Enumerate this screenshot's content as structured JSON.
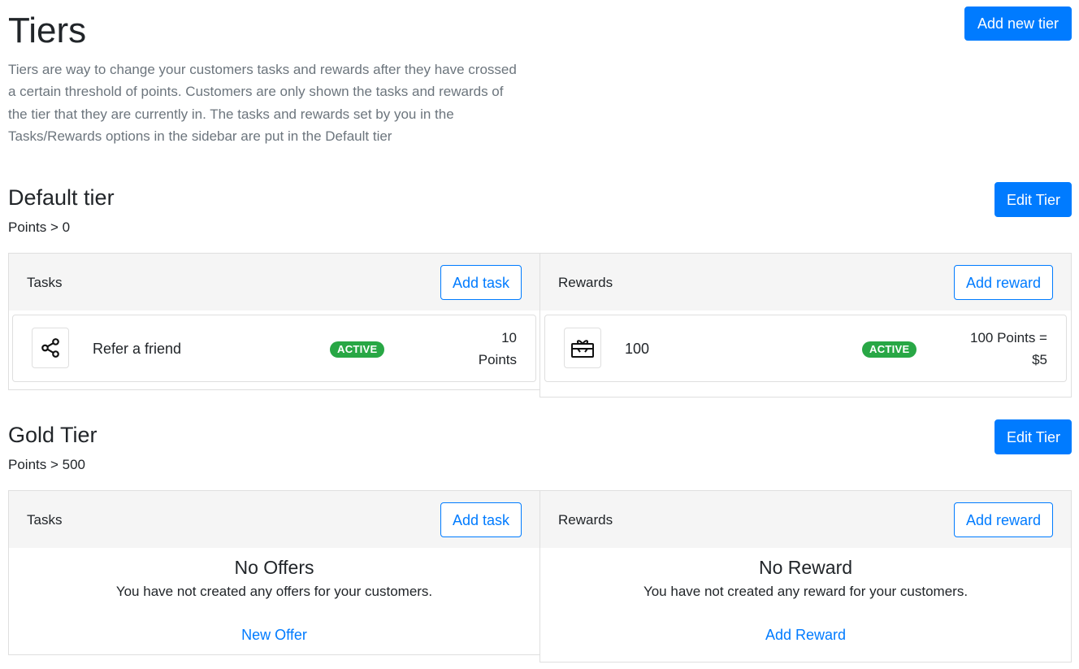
{
  "page": {
    "title": "Tiers",
    "description": "Tiers are way to change your customers tasks and rewards after they have crossed a certain threshold of points. Customers are only shown the tasks and rewards of the tier that they are currently in. The tasks and rewards set by you in the Tasks/Rewards options in the sidebar are put in the Default tier",
    "add_tier_label": "Add new tier"
  },
  "tiers": [
    {
      "name": "Default tier",
      "points": "Points > 0",
      "edit_label": "Edit Tier",
      "tasks": {
        "header": "Tasks",
        "add_label": "Add task",
        "items": [
          {
            "icon": "share-icon",
            "name": "Refer a friend",
            "status": "ACTIVE",
            "value_line1": "10",
            "value_line2": "Points"
          }
        ]
      },
      "rewards": {
        "header": "Rewards",
        "add_label": "Add reward",
        "items": [
          {
            "icon": "gift-card-icon",
            "name": "100",
            "status": "ACTIVE",
            "value_line1": "100 Points =",
            "value_line2": "$5"
          }
        ]
      }
    },
    {
      "name": "Gold Tier",
      "points": "Points > 500",
      "edit_label": "Edit Tier",
      "tasks": {
        "header": "Tasks",
        "add_label": "Add task",
        "empty_title": "No Offers",
        "empty_message": "You have not created any offers for your customers.",
        "empty_link": "New Offer"
      },
      "rewards": {
        "header": "Rewards",
        "add_label": "Add reward",
        "empty_title": "No Reward",
        "empty_message": "You have not created any reward for your customers.",
        "empty_link": "Add Reward"
      }
    }
  ],
  "colors": {
    "primary": "#007bff",
    "success": "#28a745",
    "muted": "#6c757d",
    "card_header_bg": "#f5f5f5"
  }
}
